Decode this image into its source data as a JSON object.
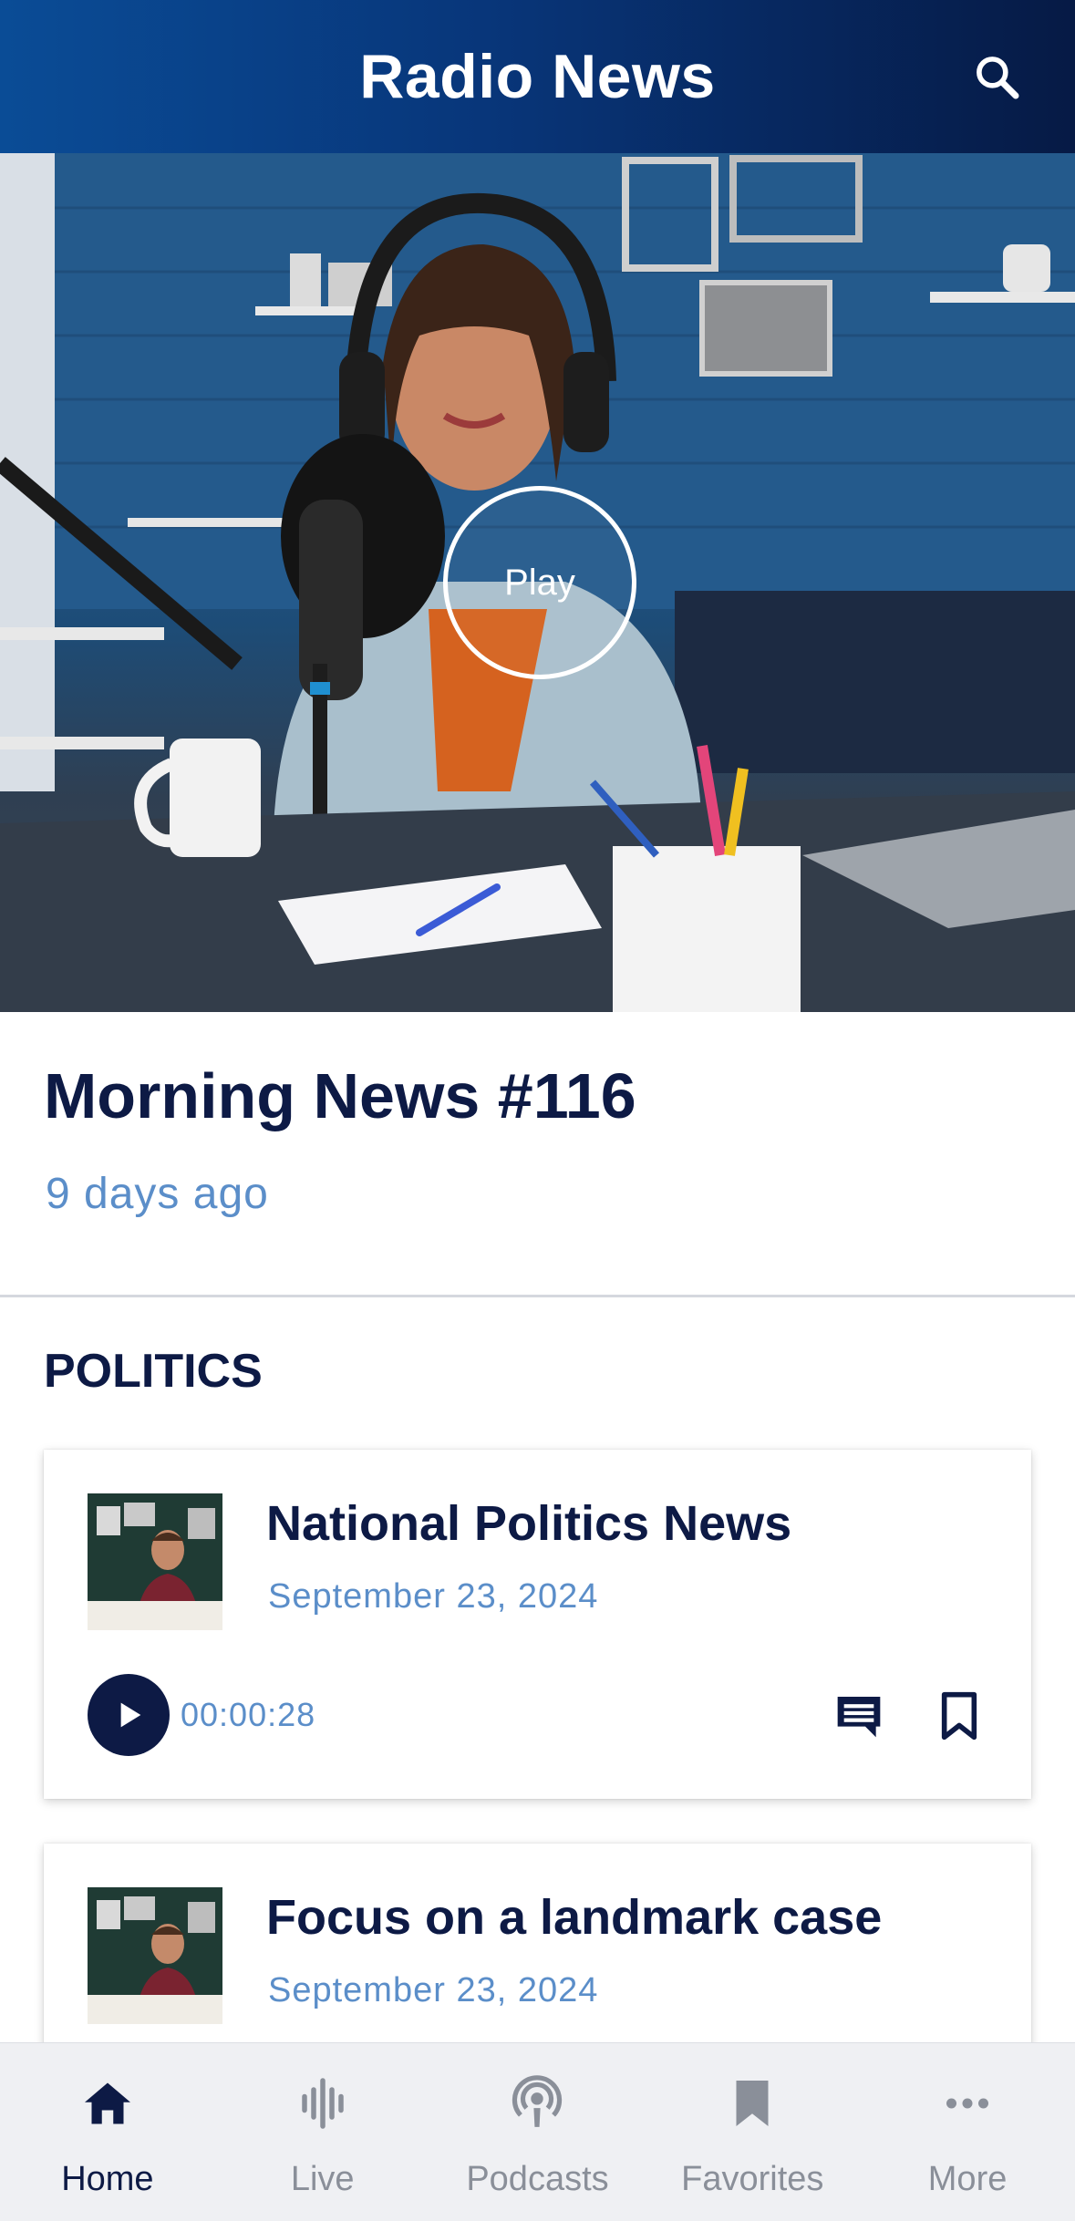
{
  "header": {
    "title": "Radio News",
    "search_icon": "search-icon"
  },
  "hero": {
    "play_label": "Play"
  },
  "episode": {
    "title": "Morning News #116",
    "date": "9 days ago"
  },
  "section": {
    "label": "POLITICS"
  },
  "cards": [
    {
      "title": "National Politics News",
      "date": "September 23, 2024",
      "duration": "00:00:28",
      "icons": [
        "play-icon",
        "comment-icon",
        "bookmark-icon"
      ]
    },
    {
      "title": "Focus on a landmark case",
      "date": "September 23, 2024"
    }
  ],
  "nav": {
    "items": [
      {
        "label": "Home",
        "icon": "home-icon",
        "active": true
      },
      {
        "label": "Live",
        "icon": "audio-wave-icon",
        "active": false
      },
      {
        "label": "Podcasts",
        "icon": "podcast-icon",
        "active": false
      },
      {
        "label": "Favorites",
        "icon": "bookmark-icon",
        "active": false
      },
      {
        "label": "More",
        "icon": "more-icon",
        "active": false
      }
    ]
  },
  "colors": {
    "navy": "#0d1a45",
    "accent_blue": "#5b8ec9",
    "header_start": "#0a4c96",
    "header_end": "#061a45"
  }
}
